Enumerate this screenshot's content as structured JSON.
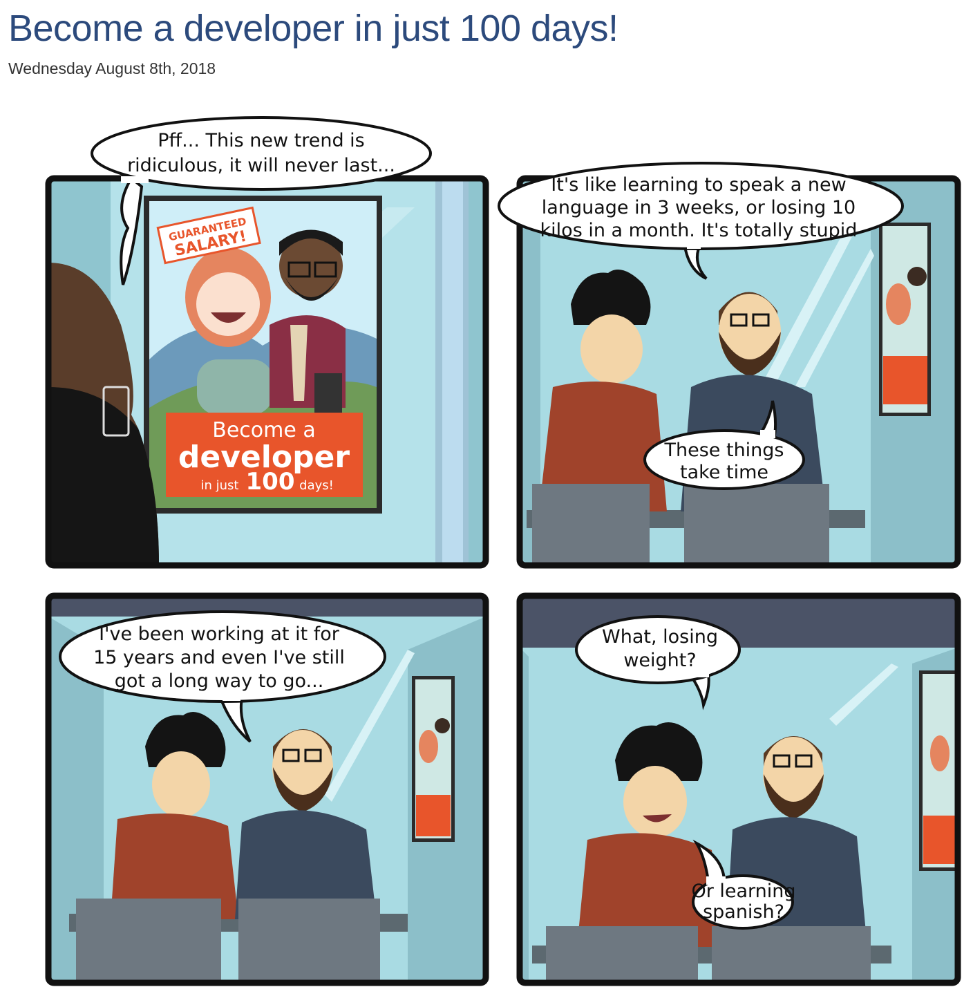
{
  "page": {
    "title": "Become a developer in just 100 days!",
    "date": "Wednesday August 8th, 2018"
  },
  "comic": {
    "panel1": {
      "bubble_line1": "Pff... This new trend is",
      "bubble_line2": "ridiculous, it will never last...",
      "stamp_line1": "GUARANTEED",
      "stamp_line2": "SALARY!",
      "poster_line1": "Become a",
      "poster_line2": "developer",
      "poster_prefix": "in just",
      "poster_number": "100",
      "poster_suffix": "days!"
    },
    "panel2": {
      "bubble1_line1": "It's like learning to speak a new",
      "bubble1_line2": "language in 3 weeks, or losing 10",
      "bubble1_line3": "kilos in a month. It's totally stupid",
      "bubble2_line1": "These things",
      "bubble2_line2": "take time"
    },
    "panel3": {
      "bubble_line1": "I've been working at it for",
      "bubble_line2": "15 years and even I've still",
      "bubble_line3": "got a long way to go..."
    },
    "panel4": {
      "bubble1_line1": "What, losing",
      "bubble1_line2": "weight?",
      "bubble2_line1": "Or learning",
      "bubble2_line2": "spanish?"
    }
  },
  "colors": {
    "title": "#2c4a7c",
    "panel_border": "#111111",
    "glass": "#a9dbe3",
    "poster_orange": "#e8552b",
    "shirt_red": "#a0432b",
    "jacket_navy": "#3b4a5e"
  }
}
